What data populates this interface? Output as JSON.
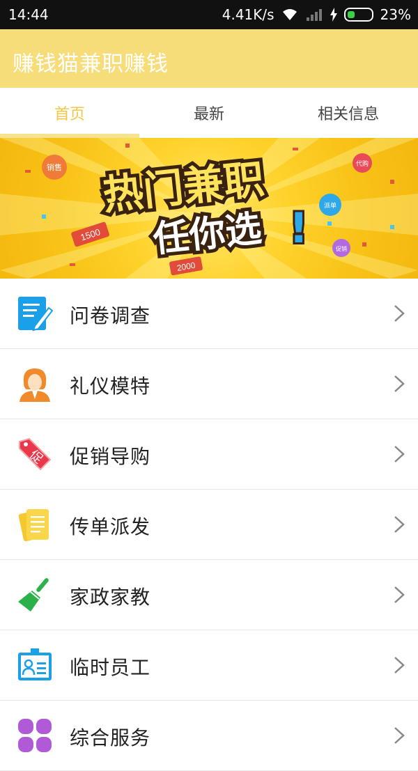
{
  "status": {
    "time": "14:44",
    "speed": "4.41K/s",
    "battery": "23%"
  },
  "app": {
    "title": "赚钱猫兼职赚钱"
  },
  "tabs": [
    {
      "label": "首页",
      "active": true
    },
    {
      "label": "最新",
      "active": false
    },
    {
      "label": "相关信息",
      "active": false
    }
  ],
  "banner": {
    "line1": "热门兼职",
    "line2": "任你选",
    "tag_numbers": [
      "1500",
      "2000"
    ],
    "bubble_labels": [
      "销售",
      "代购",
      "派单",
      "促销"
    ]
  },
  "categories": [
    {
      "label": "问卷调查",
      "icon": "survey-icon"
    },
    {
      "label": "礼仪模特",
      "icon": "model-icon"
    },
    {
      "label": "促销导购",
      "icon": "promotion-tag-icon"
    },
    {
      "label": "传单派发",
      "icon": "flyer-icon"
    },
    {
      "label": "家政家教",
      "icon": "broom-icon"
    },
    {
      "label": "临时员工",
      "icon": "id-card-icon"
    },
    {
      "label": "综合服务",
      "icon": "clover-icon"
    }
  ],
  "colors": {
    "accent": "#f2c744",
    "appbar": "#f6dd7a"
  }
}
